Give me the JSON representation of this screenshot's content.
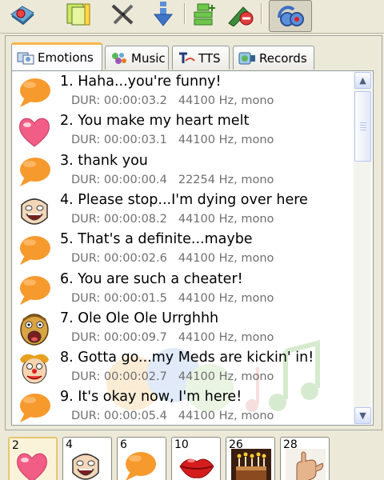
{
  "toolbar": {
    "buttons": [
      {
        "name": "speech-config-icon"
      },
      {
        "name": "copy-sound-icon"
      },
      {
        "name": "cut-tools-icon"
      },
      {
        "name": "download-arrow-icon"
      },
      {
        "name": "add-to-list-icon"
      },
      {
        "name": "edit-delete-icon"
      },
      {
        "name": "voice-changer-icon"
      }
    ]
  },
  "tabs": [
    {
      "label": "Emotions",
      "icon": "emotions-tab-icon",
      "active": true
    },
    {
      "label": "Music",
      "icon": "music-tab-icon",
      "active": false
    },
    {
      "label": "TTS",
      "icon": "tts-tab-icon",
      "active": false
    },
    {
      "label": "Records",
      "icon": "records-tab-icon",
      "active": false
    }
  ],
  "sounds": [
    {
      "title": "1. Haha...you're funny!",
      "dur": "DUR: 00:00:03.2",
      "format": "44100 Hz, mono",
      "icon": "orange-speech-bubble-icon"
    },
    {
      "title": "2. You make my heart melt",
      "dur": "DUR: 00:00:03.1",
      "format": "44100 Hz, mono",
      "icon": "pink-heart-icon"
    },
    {
      "title": "3. thank you",
      "dur": "DUR: 00:00:00.4",
      "format": "22254 Hz, mono",
      "icon": "orange-speech-bubble-icon"
    },
    {
      "title": "4. Please stop...I'm dying over here",
      "dur": "DUR: 00:00:08.2",
      "format": "44100 Hz, mono",
      "icon": "laughing-face-icon"
    },
    {
      "title": "5. That's a definite...maybe",
      "dur": "DUR: 00:00:02.6",
      "format": "44100 Hz, mono",
      "icon": "orange-speech-bubble-icon"
    },
    {
      "title": "6. You are such a cheater!",
      "dur": "DUR: 00:00:01.5",
      "format": "44100 Hz, mono",
      "icon": "orange-speech-bubble-icon"
    },
    {
      "title": "7. Ole Ole Ole Urrghhh",
      "dur": "DUR: 00:00:09.7",
      "format": "44100 Hz, mono",
      "icon": "screaming-face-icon"
    },
    {
      "title": "8. Gotta go...my Meds are kickin' in!",
      "dur": "DUR: 00:00:02.7",
      "format": "44100 Hz, mono",
      "icon": "clown-face-icon"
    },
    {
      "title": "9. It's okay now, I'm here!",
      "dur": "DUR: 00:00:05.4",
      "format": "44100 Hz, mono",
      "icon": "orange-speech-bubble-icon"
    }
  ],
  "favorites": [
    {
      "num": "2",
      "icon": "pink-heart-icon",
      "selected": true
    },
    {
      "num": "4",
      "icon": "laughing-face-icon",
      "selected": false
    },
    {
      "num": "6",
      "icon": "orange-speech-bubble-icon",
      "selected": false
    },
    {
      "num": "10",
      "icon": "red-lips-icon",
      "selected": false
    },
    {
      "num": "26",
      "icon": "birthday-cake-icon",
      "selected": false
    },
    {
      "num": "28",
      "icon": "hand-gesture-icon",
      "selected": false
    }
  ],
  "colors": {
    "window_bg": "#ece9d8",
    "active_tab_accent": "#f7b64a",
    "meta_text": "#6f6f6f",
    "bubble_orange": "#f79a2e",
    "heart_pink": "#f25d86"
  }
}
